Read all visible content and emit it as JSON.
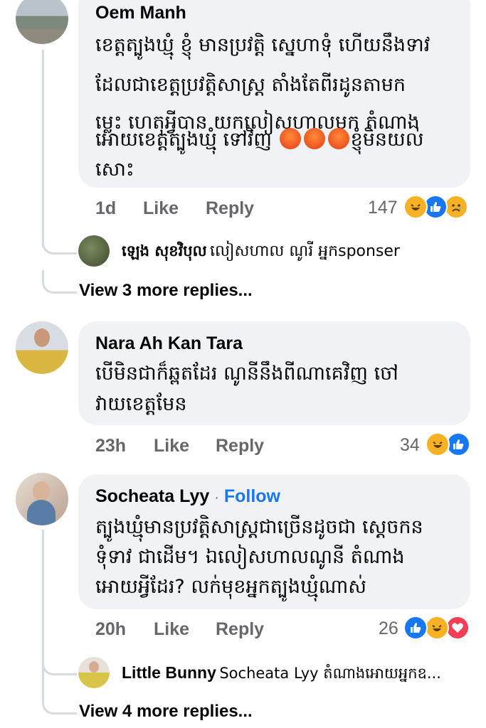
{
  "comments": [
    {
      "author": "Oem Manh",
      "lines": [
        "ខេត្តត្បូងឃ្មុំ ខ្ញុំ មានប្រវត្តិ ស្នេហាទុំ ហើយនឹងទាវ",
        "ដែលជាខេត្តប្រវត្តិសាស្ត្រ តាំងតែពីរដូនតាមក",
        "ម្លេះ ហេតុអ្វីបាន យកលៀសហាលមក តំណាង",
        "អោយខេត្តត្បូងឃ្មុំ ទៅវិញ",
        "ខ្ញុំមិនយល់",
        "សោះ"
      ],
      "time": "1d",
      "like": "Like",
      "reply": "Reply",
      "reaction_count": "147",
      "reactions": [
        "haha",
        "like",
        "sad"
      ],
      "inline_emoji": [
        "angry",
        "angry",
        "angry"
      ],
      "nested_reply": {
        "author": "ឡេង សុខវិបុល",
        "text": "លៀសហាល ណូរី អ្នកsponser"
      },
      "more_replies": "View 3 more replies..."
    },
    {
      "author": "Nara Ah Kan Tara",
      "lines": [
        "បើមិនជាក៏ឆ្ពតដែរ ណូនីនឹងពីណាគេវិញ ចៅ",
        "វាយខេត្តមែន"
      ],
      "time": "23h",
      "like": "Like",
      "reply": "Reply",
      "reaction_count": "34",
      "reactions": [
        "haha",
        "like"
      ]
    },
    {
      "author": "Socheata Lyy",
      "follow": "Follow",
      "separator": "·",
      "lines": [
        "ត្បូងឃ្មុំមានប្រវត្តិសាស្ត្រជាច្រើនដូចជា ស្តេចកន",
        "ទុំទាវ ជាដើម។ ឯលៀសហាលណូនី តំណាង",
        "អោយអ្វីដែរ? លក់មុខអ្នកត្បូងឃ្មុំណាស់"
      ],
      "time": "20h",
      "like": "Like",
      "reply": "Reply",
      "reaction_count": "26",
      "reactions": [
        "like",
        "haha",
        "love"
      ],
      "nested_reply": {
        "author": "Little Bunny",
        "text": "Socheata Lyy តំណាងអោយអ្នកឧ..."
      },
      "more_replies": "View 4 more replies..."
    }
  ],
  "colors": {
    "bubble": "#f0f2f5",
    "secondary_text": "#65676b",
    "follow": "#1877f2",
    "like_blue": "#1877f2",
    "haha_yellow": "#f7b125",
    "love_red": "#f33e58",
    "angry_orange": "#f05b23"
  }
}
